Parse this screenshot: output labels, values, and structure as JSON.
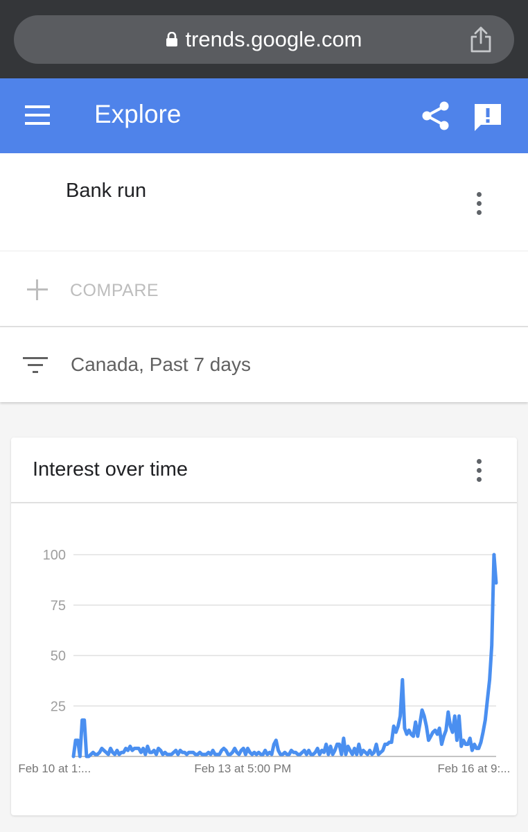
{
  "browser": {
    "url": "trends.google.com"
  },
  "app_bar": {
    "title": "Explore"
  },
  "search_term": {
    "label": "Bank run"
  },
  "compare": {
    "label": "COMPARE"
  },
  "filter": {
    "label": "Canada, Past 7 days"
  },
  "chart_card": {
    "title": "Interest over time"
  },
  "colors": {
    "app_bar": "#4f83ea",
    "line": "#4a8ff0",
    "browser": "#343639"
  },
  "chart_data": {
    "type": "line",
    "title": "Interest over time",
    "xlabel": "",
    "ylabel": "",
    "ylim": [
      0,
      100
    ],
    "y_ticks": [
      25,
      50,
      75,
      100
    ],
    "x_tick_labels": [
      "Feb 10 at 1:...",
      "Feb 13 at 5:00 PM",
      "Feb 16 at 9:..."
    ],
    "x_tick_positions": [
      0.086,
      0.458,
      0.915
    ],
    "grid": true,
    "legend": "none",
    "series": [
      {
        "values": [
          0,
          8,
          8,
          0,
          18,
          18,
          0,
          0,
          1,
          2,
          1,
          1,
          2,
          4,
          3,
          2,
          1,
          4,
          2,
          1,
          3,
          1,
          2,
          2,
          4,
          3,
          5,
          3,
          4,
          4,
          4,
          2,
          4,
          1,
          5,
          2,
          2,
          3,
          1,
          4,
          3,
          1,
          2,
          1,
          1,
          1,
          2,
          3,
          1,
          3,
          2,
          2,
          1,
          2,
          2,
          2,
          1,
          1,
          2,
          1,
          1,
          1,
          2,
          1,
          3,
          1,
          1,
          1,
          3,
          4,
          3,
          1,
          1,
          2,
          4,
          2,
          1,
          3,
          4,
          1,
          4,
          2,
          1,
          2,
          1,
          2,
          1,
          1,
          3,
          1,
          2,
          1,
          6,
          8,
          3,
          1,
          1,
          2,
          1,
          1,
          3,
          2,
          2,
          1,
          1,
          2,
          3,
          1,
          3,
          1,
          1,
          2,
          4,
          1,
          3,
          2,
          6,
          1,
          5,
          1,
          3,
          6,
          6,
          1,
          9,
          1,
          5,
          3,
          1,
          4,
          1,
          6,
          1,
          3,
          2,
          1,
          3,
          1,
          2,
          6,
          1,
          2,
          3,
          6,
          6,
          7,
          7,
          15,
          12,
          15,
          20,
          38,
          14,
          11,
          13,
          11,
          10,
          17,
          10,
          16,
          23,
          20,
          15,
          8,
          10,
          12,
          13,
          11,
          14,
          6,
          10,
          13,
          22,
          15,
          12,
          20,
          8,
          20,
          5,
          8,
          6,
          6,
          9,
          3,
          6,
          4,
          4,
          7,
          12,
          18,
          28,
          38,
          55,
          100,
          86
        ]
      }
    ]
  }
}
